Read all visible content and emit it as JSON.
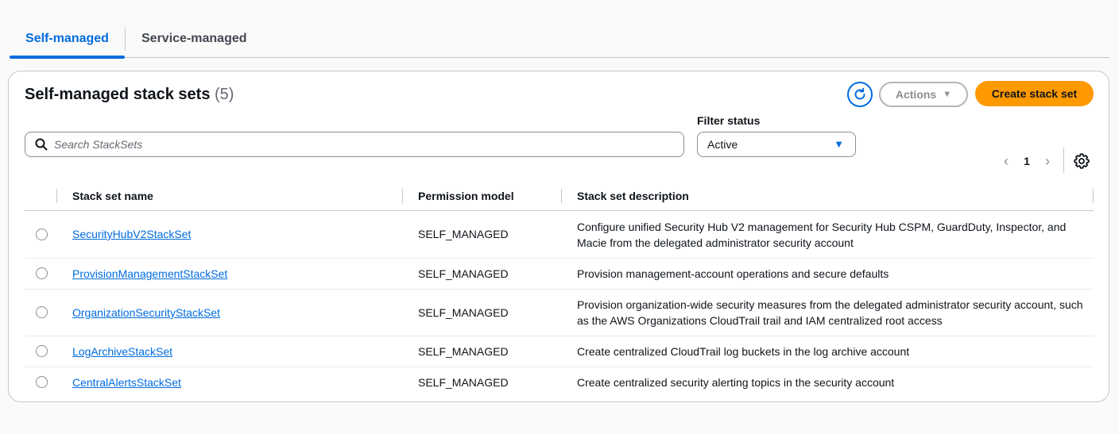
{
  "tabs": [
    {
      "label": "Self-managed",
      "active": true
    },
    {
      "label": "Service-managed",
      "active": false
    }
  ],
  "panel": {
    "title": "Self-managed stack sets",
    "count": "(5)",
    "actions_label": "Actions",
    "create_label": "Create stack set"
  },
  "search": {
    "placeholder": "Search StackSets",
    "value": ""
  },
  "filter": {
    "label": "Filter status",
    "selected": "Active"
  },
  "pagination": {
    "current_page": "1"
  },
  "table": {
    "columns": [
      "Stack set name",
      "Permission model",
      "Stack set description"
    ],
    "rows": [
      {
        "name": "SecurityHubV2StackSet",
        "permission": "SELF_MANAGED",
        "description": "Configure unified Security Hub V2 management for Security Hub CSPM, GuardDuty, Inspector, and Macie from the delegated administrator security account"
      },
      {
        "name": "ProvisionManagementStackSet",
        "permission": "SELF_MANAGED",
        "description": "Provision management-account operations and secure defaults"
      },
      {
        "name": "OrganizationSecurityStackSet",
        "permission": "SELF_MANAGED",
        "description": "Provision organization-wide security measures from the delegated administrator security account, such as the AWS Organizations CloudTrail trail and IAM centralized root access"
      },
      {
        "name": "LogArchiveStackSet",
        "permission": "SELF_MANAGED",
        "description": "Create centralized CloudTrail log buckets in the log archive account"
      },
      {
        "name": "CentralAlertsStackSet",
        "permission": "SELF_MANAGED",
        "description": "Create centralized security alerting topics in the security account"
      }
    ]
  },
  "colors": {
    "accent": "#006ce0",
    "primary_button": "#ff9900",
    "border": "#c6c6cd"
  },
  "icons": [
    "refresh-icon",
    "caret-down-icon",
    "search-icon",
    "chevron-left-icon",
    "chevron-right-icon",
    "settings-icon"
  ]
}
